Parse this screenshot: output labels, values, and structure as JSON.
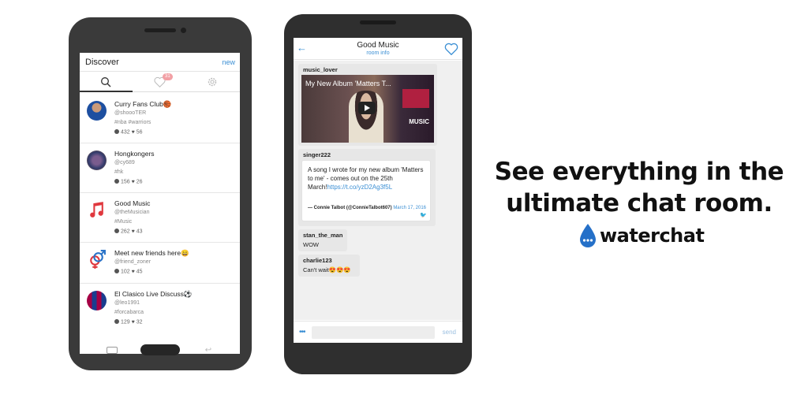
{
  "discover": {
    "title": "Discover",
    "new_label": "new",
    "tabs": [
      {
        "name": "search",
        "icon": "search-icon"
      },
      {
        "name": "favorites",
        "icon": "heart-icon",
        "badge": "31"
      },
      {
        "name": "settings",
        "icon": "gear-icon"
      }
    ],
    "rooms": [
      {
        "name": "Curry Fans Club🏀",
        "owner": "@shoooTER",
        "tags": "#nba #warriors",
        "members": "432",
        "likes": "56"
      },
      {
        "name": "Hongkongers",
        "owner": "@cy689",
        "tags": "#hk",
        "members": "156",
        "likes": "26"
      },
      {
        "name": "Good Music",
        "owner": "@theMusician",
        "tags": "#Music",
        "members": "262",
        "likes": "43"
      },
      {
        "name": "Meet new friends here😄",
        "owner": "@friend_zoner",
        "tags": "",
        "members": "102",
        "likes": "45"
      },
      {
        "name": "El Clasico Live Discuss⚽",
        "owner": "@leo1991",
        "tags": "#forcabarca",
        "members": "129",
        "likes": "32"
      }
    ]
  },
  "chat": {
    "room_title": "Good Music",
    "room_info": "room info",
    "messages": [
      {
        "user": "music_lover",
        "video_title": "My New Album 'Matters T...",
        "video_badge": "MUSIC"
      },
      {
        "user": "singer222",
        "tweet_text": "A song I wrote for my new album 'Matters to me' - comes out on the 25th March!",
        "tweet_link": "https://t.co/yzD2Ag3f5L",
        "tweet_author": "— Connie Talbot (@ConnieTalbot607)",
        "tweet_date": "March 17, 2016"
      },
      {
        "user": "stan_the_man",
        "text": "WOW"
      },
      {
        "user": "charlie123",
        "text": "Can't wait😍😍😍"
      }
    ],
    "input_placeholder": "",
    "send_label": "send"
  },
  "promo": {
    "tagline_line1": "See everything in the",
    "tagline_line2": "ultimate chat room.",
    "brand": "waterchat"
  },
  "colors": {
    "accent": "#3b8fd4",
    "phone_body": "#3a3a3a",
    "badge": "#f2a0a5"
  }
}
